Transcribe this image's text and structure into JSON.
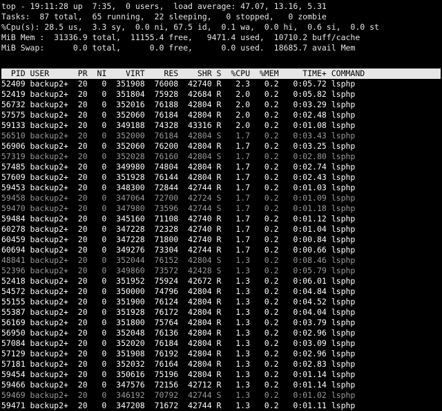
{
  "summary": [
    "top - 19:11:28 up  7:35,  0 users,  load average: 47.07, 13.16, 5.31",
    "Tasks:  87 total,  65 running,  22 sleeping,   0 stopped,   0 zombie",
    "%Cpu(s): 28.5 us,  3.3 sy,  0.0 ni, 67.5 id,  0.1 wa,  0.0 hi,  0.6 si,  0.0 st",
    "MiB Mem :  31336.9 total,  11155.4 free,   9471.4 used,  10710.2 buff/cache",
    "MiB Swap:      0.0 total,      0.0 free,      0.0 used.  18685.7 avail Mem"
  ],
  "header": "  PID USER      PR  NI    VIRT    RES    SHR S  %CPU  %MEM     TIME+ COMMAND",
  "processes": [
    {
      "pid": "52409",
      "user": "backup2+",
      "pr": "20",
      "ni": "0",
      "virt": "351908",
      "res": "76008",
      "shr": "42740",
      "s": "R",
      "cpu": "2.3",
      "mem": "0.2",
      "time": "0:05.72",
      "cmd": "lsphp"
    },
    {
      "pid": "52419",
      "user": "backup2+",
      "pr": "20",
      "ni": "0",
      "virt": "351804",
      "res": "75928",
      "shr": "42684",
      "s": "R",
      "cpu": "2.0",
      "mem": "0.2",
      "time": "0:05.82",
      "cmd": "lsphp"
    },
    {
      "pid": "56732",
      "user": "backup2+",
      "pr": "20",
      "ni": "0",
      "virt": "352016",
      "res": "76188",
      "shr": "42804",
      "s": "R",
      "cpu": "2.0",
      "mem": "0.2",
      "time": "0:03.29",
      "cmd": "lsphp"
    },
    {
      "pid": "57575",
      "user": "backup2+",
      "pr": "20",
      "ni": "0",
      "virt": "352060",
      "res": "76184",
      "shr": "42804",
      "s": "R",
      "cpu": "2.0",
      "mem": "0.2",
      "time": "0:02.48",
      "cmd": "lsphp"
    },
    {
      "pid": "59133",
      "user": "backup2+",
      "pr": "20",
      "ni": "0",
      "virt": "349188",
      "res": "74328",
      "shr": "43316",
      "s": "R",
      "cpu": "2.0",
      "mem": "0.2",
      "time": "0:01.08",
      "cmd": "lsphp"
    },
    {
      "pid": "56510",
      "user": "backup2+",
      "pr": "20",
      "ni": "0",
      "virt": "352000",
      "res": "76184",
      "shr": "42804",
      "s": "S",
      "cpu": "1.7",
      "mem": "0.2",
      "time": "0:03.43",
      "cmd": "lsphp"
    },
    {
      "pid": "56906",
      "user": "backup2+",
      "pr": "20",
      "ni": "0",
      "virt": "352060",
      "res": "76200",
      "shr": "42804",
      "s": "R",
      "cpu": "1.7",
      "mem": "0.2",
      "time": "0:03.25",
      "cmd": "lsphp"
    },
    {
      "pid": "57319",
      "user": "backup2+",
      "pr": "20",
      "ni": "0",
      "virt": "352028",
      "res": "76160",
      "shr": "42804",
      "s": "S",
      "cpu": "1.7",
      "mem": "0.2",
      "time": "0:02.80",
      "cmd": "lsphp"
    },
    {
      "pid": "57485",
      "user": "backup2+",
      "pr": "20",
      "ni": "0",
      "virt": "349980",
      "res": "74804",
      "shr": "42804",
      "s": "R",
      "cpu": "1.7",
      "mem": "0.2",
      "time": "0:02.74",
      "cmd": "lsphp"
    },
    {
      "pid": "57609",
      "user": "backup2+",
      "pr": "20",
      "ni": "0",
      "virt": "351928",
      "res": "76144",
      "shr": "42804",
      "s": "R",
      "cpu": "1.7",
      "mem": "0.2",
      "time": "0:02.43",
      "cmd": "lsphp"
    },
    {
      "pid": "59453",
      "user": "backup2+",
      "pr": "20",
      "ni": "0",
      "virt": "348300",
      "res": "72844",
      "shr": "42744",
      "s": "R",
      "cpu": "1.7",
      "mem": "0.2",
      "time": "0:01.03",
      "cmd": "lsphp"
    },
    {
      "pid": "59458",
      "user": "backup2+",
      "pr": "20",
      "ni": "0",
      "virt": "347064",
      "res": "72700",
      "shr": "42724",
      "s": "S",
      "cpu": "1.7",
      "mem": "0.2",
      "time": "0:01.09",
      "cmd": "lsphp"
    },
    {
      "pid": "59470",
      "user": "backup2+",
      "pr": "20",
      "ni": "0",
      "virt": "347980",
      "res": "73596",
      "shr": "42744",
      "s": "S",
      "cpu": "1.7",
      "mem": "0.2",
      "time": "0:01.18",
      "cmd": "lsphp"
    },
    {
      "pid": "59484",
      "user": "backup2+",
      "pr": "20",
      "ni": "0",
      "virt": "345160",
      "res": "71108",
      "shr": "42740",
      "s": "R",
      "cpu": "1.7",
      "mem": "0.2",
      "time": "0:01.12",
      "cmd": "lsphp"
    },
    {
      "pid": "60278",
      "user": "backup2+",
      "pr": "20",
      "ni": "0",
      "virt": "347228",
      "res": "72328",
      "shr": "42740",
      "s": "R",
      "cpu": "1.7",
      "mem": "0.2",
      "time": "0:01.04",
      "cmd": "lsphp"
    },
    {
      "pid": "60459",
      "user": "backup2+",
      "pr": "20",
      "ni": "0",
      "virt": "347228",
      "res": "71800",
      "shr": "42740",
      "s": "R",
      "cpu": "1.7",
      "mem": "0.2",
      "time": "0:00.84",
      "cmd": "lsphp"
    },
    {
      "pid": "60694",
      "user": "backup2+",
      "pr": "20",
      "ni": "0",
      "virt": "349276",
      "res": "73304",
      "shr": "42744",
      "s": "R",
      "cpu": "1.7",
      "mem": "0.2",
      "time": "0:00.66",
      "cmd": "lsphp"
    },
    {
      "pid": "48841",
      "user": "backup2+",
      "pr": "20",
      "ni": "0",
      "virt": "352044",
      "res": "76152",
      "shr": "42804",
      "s": "S",
      "cpu": "1.3",
      "mem": "0.2",
      "time": "0:08.46",
      "cmd": "lsphp"
    },
    {
      "pid": "52396",
      "user": "backup2+",
      "pr": "20",
      "ni": "0",
      "virt": "349860",
      "res": "73572",
      "shr": "42428",
      "s": "S",
      "cpu": "1.3",
      "mem": "0.2",
      "time": "0:05.79",
      "cmd": "lsphp"
    },
    {
      "pid": "52418",
      "user": "backup2+",
      "pr": "20",
      "ni": "0",
      "virt": "351952",
      "res": "75924",
      "shr": "42672",
      "s": "R",
      "cpu": "1.3",
      "mem": "0.2",
      "time": "0:06.01",
      "cmd": "lsphp"
    },
    {
      "pid": "54572",
      "user": "backup2+",
      "pr": "20",
      "ni": "0",
      "virt": "350000",
      "res": "74796",
      "shr": "42804",
      "s": "R",
      "cpu": "1.3",
      "mem": "0.2",
      "time": "0:04.84",
      "cmd": "lsphp"
    },
    {
      "pid": "55155",
      "user": "backup2+",
      "pr": "20",
      "ni": "0",
      "virt": "351900",
      "res": "76124",
      "shr": "42804",
      "s": "R",
      "cpu": "1.3",
      "mem": "0.2",
      "time": "0:04.52",
      "cmd": "lsphp"
    },
    {
      "pid": "55387",
      "user": "backup2+",
      "pr": "20",
      "ni": "0",
      "virt": "351928",
      "res": "76172",
      "shr": "42804",
      "s": "R",
      "cpu": "1.3",
      "mem": "0.2",
      "time": "0:04.04",
      "cmd": "lsphp"
    },
    {
      "pid": "56169",
      "user": "backup2+",
      "pr": "20",
      "ni": "0",
      "virt": "351800",
      "res": "75764",
      "shr": "42804",
      "s": "R",
      "cpu": "1.3",
      "mem": "0.2",
      "time": "0:03.79",
      "cmd": "lsphp"
    },
    {
      "pid": "56950",
      "user": "backup2+",
      "pr": "20",
      "ni": "0",
      "virt": "352048",
      "res": "76136",
      "shr": "42804",
      "s": "R",
      "cpu": "1.3",
      "mem": "0.2",
      "time": "0:02.96",
      "cmd": "lsphp"
    },
    {
      "pid": "57084",
      "user": "backup2+",
      "pr": "20",
      "ni": "0",
      "virt": "352020",
      "res": "76184",
      "shr": "42804",
      "s": "R",
      "cpu": "1.3",
      "mem": "0.2",
      "time": "0:03.09",
      "cmd": "lsphp"
    },
    {
      "pid": "57129",
      "user": "backup2+",
      "pr": "20",
      "ni": "0",
      "virt": "351908",
      "res": "76192",
      "shr": "42804",
      "s": "R",
      "cpu": "1.3",
      "mem": "0.2",
      "time": "0:02.96",
      "cmd": "lsphp"
    },
    {
      "pid": "57181",
      "user": "backup2+",
      "pr": "20",
      "ni": "0",
      "virt": "352032",
      "res": "76164",
      "shr": "42804",
      "s": "R",
      "cpu": "1.3",
      "mem": "0.2",
      "time": "0:02.83",
      "cmd": "lsphp"
    },
    {
      "pid": "59454",
      "user": "backup2+",
      "pr": "20",
      "ni": "0",
      "virt": "350616",
      "res": "75196",
      "shr": "42804",
      "s": "R",
      "cpu": "1.3",
      "mem": "0.2",
      "time": "0:01.14",
      "cmd": "lsphp"
    },
    {
      "pid": "59466",
      "user": "backup2+",
      "pr": "20",
      "ni": "0",
      "virt": "347576",
      "res": "72156",
      "shr": "42712",
      "s": "R",
      "cpu": "1.3",
      "mem": "0.2",
      "time": "0:01.14",
      "cmd": "lsphp"
    },
    {
      "pid": "59469",
      "user": "backup2+",
      "pr": "20",
      "ni": "0",
      "virt": "346192",
      "res": "70792",
      "shr": "42744",
      "s": "S",
      "cpu": "1.3",
      "mem": "0.2",
      "time": "0:01.02",
      "cmd": "lsphp"
    },
    {
      "pid": "59471",
      "user": "backup2+",
      "pr": "20",
      "ni": "0",
      "virt": "347208",
      "res": "71672",
      "shr": "42744",
      "s": "R",
      "cpu": "1.3",
      "mem": "0.2",
      "time": "0:01.11",
      "cmd": "lsphp"
    }
  ]
}
